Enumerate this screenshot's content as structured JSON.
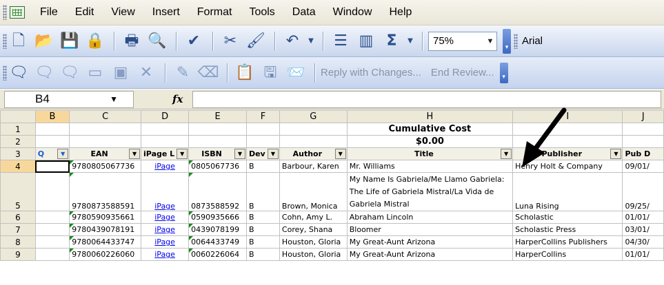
{
  "menu": [
    "File",
    "Edit",
    "View",
    "Insert",
    "Format",
    "Tools",
    "Data",
    "Window",
    "Help"
  ],
  "toolbar": {
    "zoom": "75%",
    "font": "Arial",
    "reply_label": "Reply with Changes...",
    "end_review_label": "End Review..."
  },
  "formula_bar": {
    "name_box": "B4",
    "fx_label": "fx",
    "formula": ""
  },
  "columns": [
    "B",
    "C",
    "D",
    "E",
    "F",
    "G",
    "H",
    "I",
    "J"
  ],
  "summary": {
    "title": "Cumulative Cost",
    "value": "$0.00"
  },
  "headers": {
    "B": "Q",
    "C": "EAN",
    "D": "iPage L",
    "E": "ISBN",
    "F": "Dev",
    "G": "Author",
    "H": "Title",
    "I": "Publisher",
    "J": "Pub D"
  },
  "rows": [
    {
      "num": "1"
    },
    {
      "num": "2"
    },
    {
      "num": "3"
    },
    {
      "num": "4",
      "ean": "9780805067736",
      "ipage": "iPage",
      "isbn": "0805067736",
      "dev": "B",
      "author": "Barbour, Karen",
      "title": "Mr. Williams",
      "publisher": "Henry Holt & Company",
      "pubdate": "09/01/"
    },
    {
      "num": "5",
      "ean": "9780873588591",
      "ipage": "iPage",
      "isbn": "0873588592",
      "dev": "B",
      "author": "Brown, Monica",
      "title": "My Name Is Gabriela/Me Llamo Gabriela: The Life of Gabriela Mistral/La Vida de Gabriela Mistral",
      "publisher": "Luna Rising",
      "pubdate": "09/25/"
    },
    {
      "num": "6",
      "ean": "9780590935661",
      "ipage": "iPage",
      "isbn": "0590935666",
      "dev": "B",
      "author": "Cohn, Amy L.",
      "title": "Abraham Lincoln",
      "publisher": "Scholastic",
      "pubdate": "01/01/"
    },
    {
      "num": "7",
      "ean": "9780439078191",
      "ipage": "iPage",
      "isbn": "0439078199",
      "dev": "B",
      "author": "Corey, Shana",
      "title": "Bloomer",
      "publisher": "Scholastic Press",
      "pubdate": "03/01/"
    },
    {
      "num": "8",
      "ean": "9780064433747",
      "ipage": "iPage",
      "isbn": "0064433749",
      "dev": "B",
      "author": "Houston, Gloria",
      "title": "My Great-Aunt Arizona",
      "publisher": "HarperCollins Publishers",
      "pubdate": "04/30/"
    },
    {
      "num": "9",
      "ean": "9780060226060",
      "ipage": "iPage",
      "isbn": "0060226064",
      "dev": "B",
      "author": "Houston, Gloria",
      "title": "My Great-Aunt Arizona",
      "publisher": "HarperCollins",
      "pubdate": "01/01/"
    }
  ],
  "colors": {
    "accent": "#f8d89a",
    "toolbar": "#c8d6ee",
    "link": "#0000ee"
  }
}
